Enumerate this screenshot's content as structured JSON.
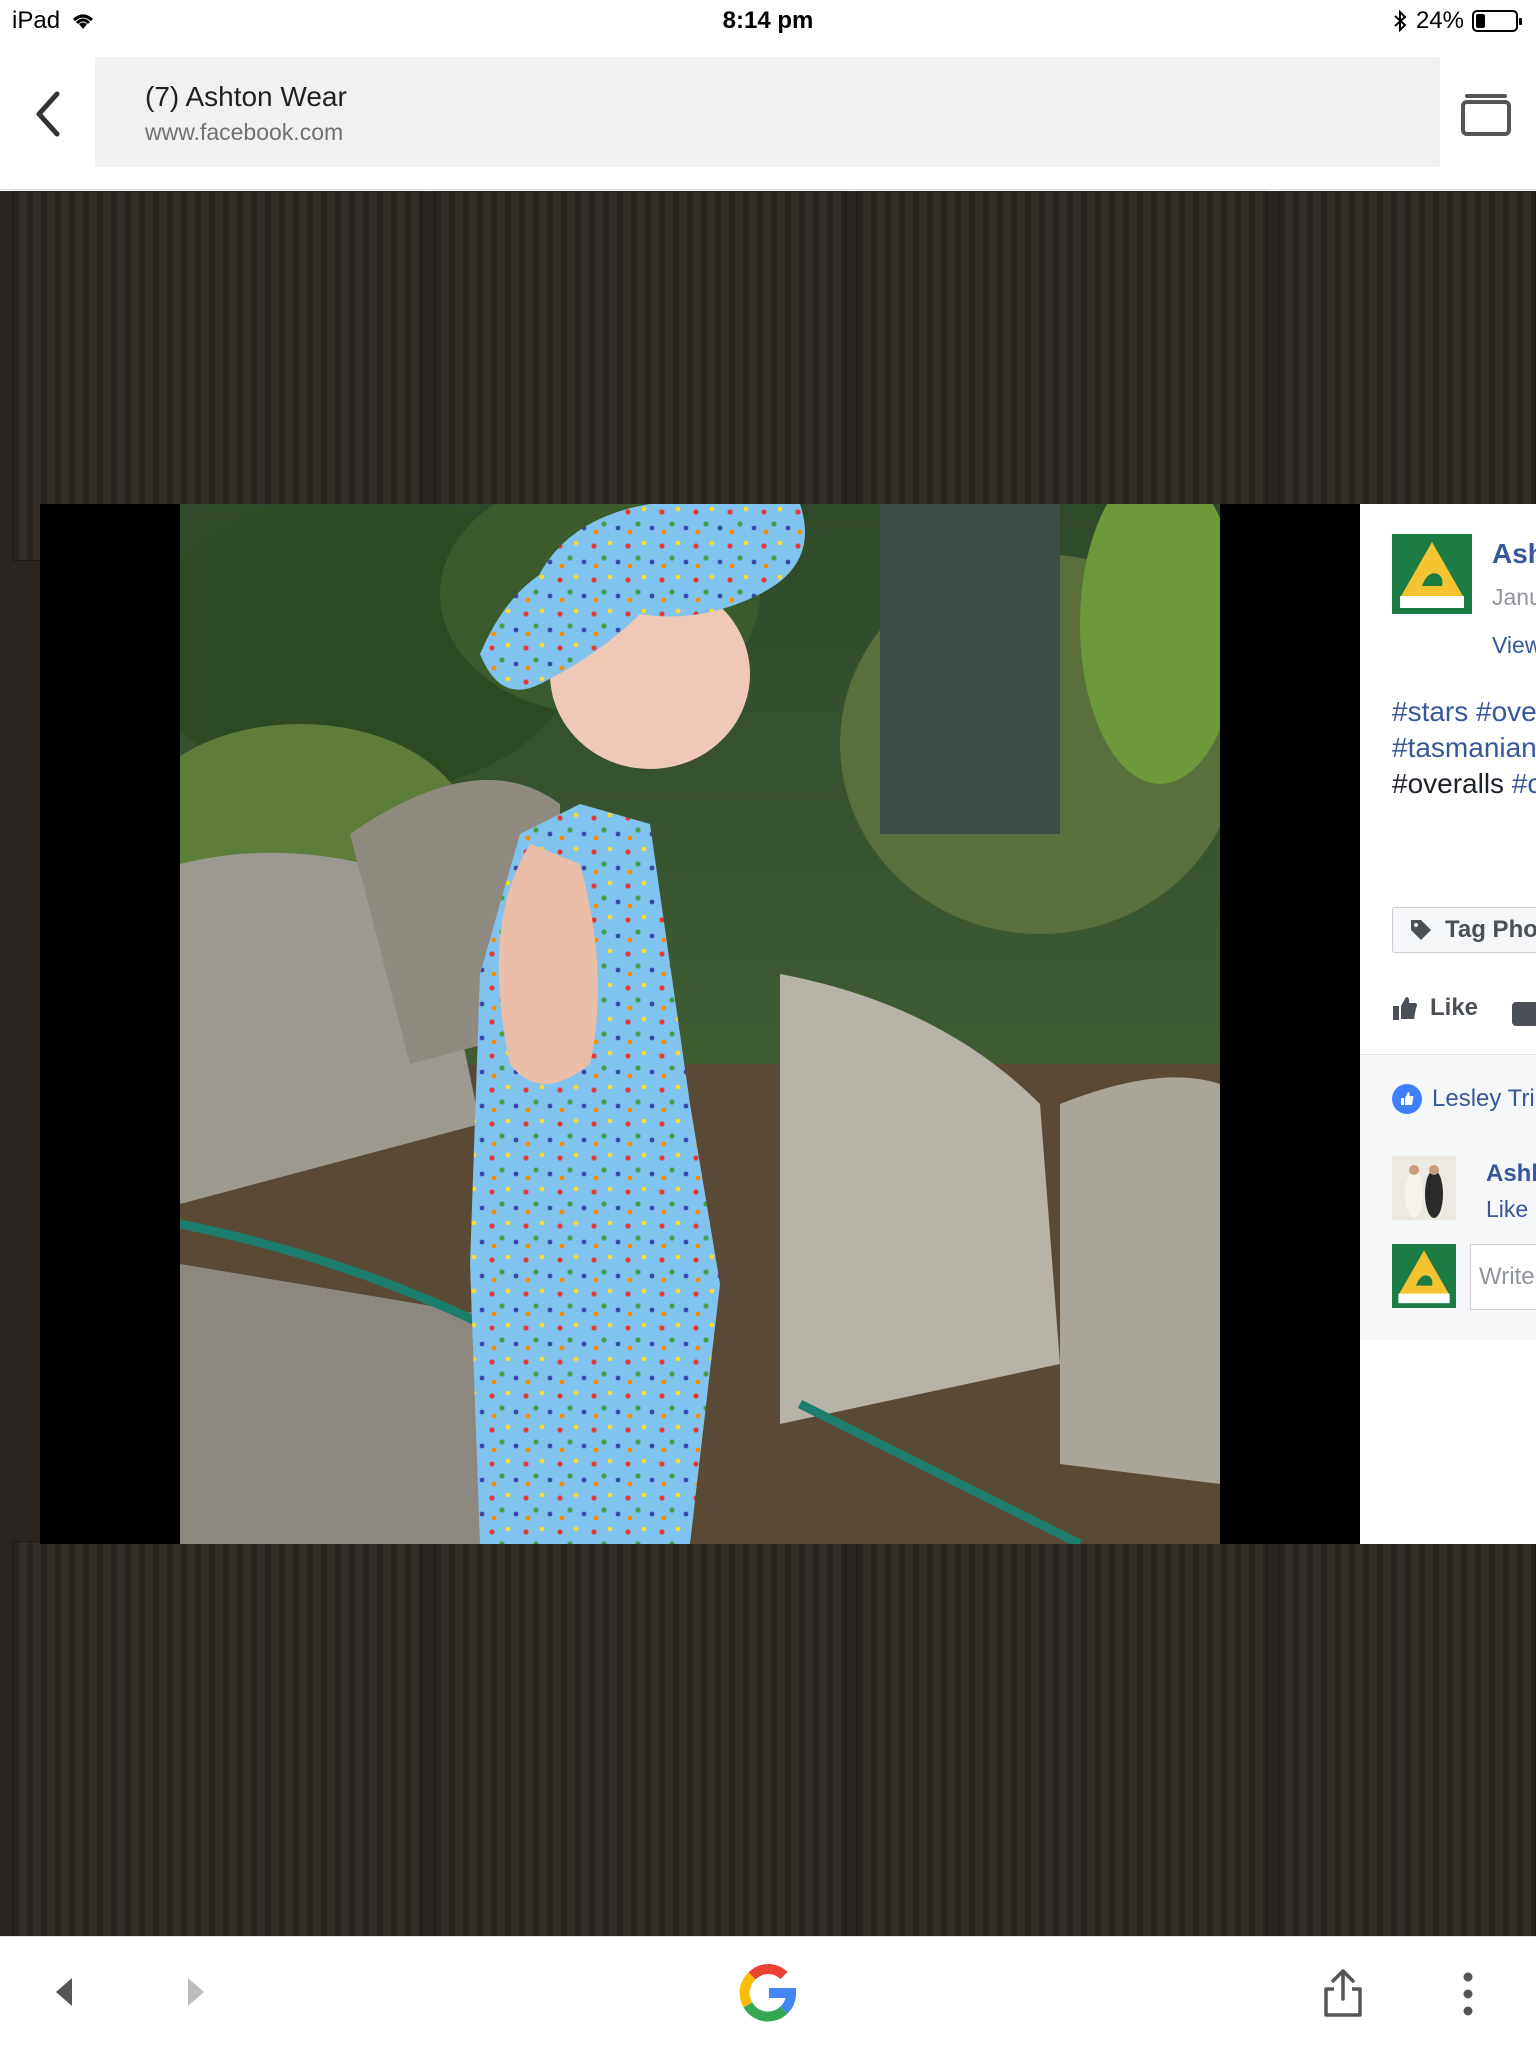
{
  "status_bar": {
    "device": "iPad",
    "time": "8:14 pm",
    "battery": "24%",
    "battery_level": 0.24
  },
  "browser": {
    "page_title": "(7) Ashton Wear",
    "url": "www.facebook.com"
  },
  "icons": {
    "back": "chevron-left-icon",
    "tabs": "tabs-icon",
    "wifi": "wifi-icon",
    "bluetooth": "bluetooth-icon",
    "nav_back": "triangle-left-icon",
    "nav_forward": "triangle-right-icon",
    "google": "google-g-icon",
    "share": "share-icon",
    "more": "vertical-dots-icon",
    "tag": "tag-icon",
    "like": "thumbs-up-icon",
    "comment": "comment-icon"
  },
  "photo_panel": {
    "page_name": "Ash",
    "date": "Janu",
    "view_link": "View",
    "caption_line1": "#stars #ove",
    "caption_line2": "#tasmanian",
    "caption_line3_plain": "#overalls ",
    "caption_line3_tag": "#c",
    "tag_button": "Tag Pho",
    "like_button": "Like",
    "liked_by": "Lesley Tri",
    "comment_author": "Ashle",
    "comment_actions": "Like ·",
    "write_placeholder": "Write"
  },
  "colors": {
    "facebook_blue": "#365899",
    "like_blue": "#4080ff",
    "overlay_dark": "#2a2520",
    "photo_black": "#000000"
  }
}
